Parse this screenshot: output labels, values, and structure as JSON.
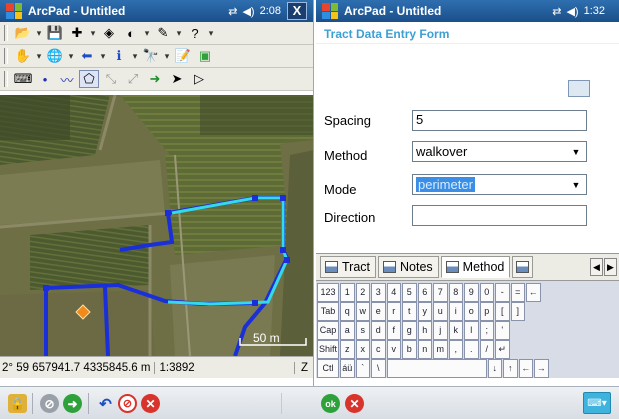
{
  "left_window": {
    "title": "ArcPad - Untitled",
    "time": "2:08",
    "close_label": "X",
    "signal_icon": "signal-icon",
    "volume_icon": "volume-icon"
  },
  "right_window": {
    "title": "ArcPad - Untitled",
    "time": "1:32"
  },
  "toolbar_rows": [
    [
      "open-folder-icon",
      "save-icon",
      "add-layer-icon",
      "layers-icon",
      "legend-icon",
      "tools-icon",
      "help-icon"
    ],
    [
      "pan-hand-icon",
      "globe-zoom-icon",
      "back-arrow-icon",
      "identify-icon",
      "find-icon",
      "notes-icon",
      "form-icon"
    ],
    [
      "keyboard-icon",
      "point-icon",
      "polyline-icon",
      "polygon-icon",
      "vertex-edit-icon",
      "vertex-add-icon",
      "gps-go-icon",
      "select-arrow-icon",
      "select-outline-icon"
    ]
  ],
  "map": {
    "scale_bar_label": "50 m",
    "accent_line_color": "#36d9e8",
    "boundary_color": "#1a2fd8",
    "marker_color": "#f08a1a"
  },
  "statusbar": {
    "coords": "2° 59 657941.7 4335845.6 m",
    "scale": "1:3892",
    "z_label": "Z"
  },
  "form": {
    "title": "Tract Data Entry Form",
    "fields": {
      "spacing": {
        "label": "Spacing",
        "value": "5"
      },
      "method": {
        "label": "Method",
        "value": "walkover"
      },
      "mode": {
        "label": "Mode",
        "value": "perimeter"
      },
      "direction": {
        "label": "Direction",
        "value": ""
      }
    },
    "tabs": [
      "Tract",
      "Notes",
      "Method"
    ]
  },
  "keyboard": {
    "rows": [
      [
        "123",
        "1",
        "2",
        "3",
        "4",
        "5",
        "6",
        "7",
        "8",
        "9",
        "0",
        "-",
        "=",
        "←"
      ],
      [
        "Tab",
        "q",
        "w",
        "e",
        "r",
        "t",
        "y",
        "u",
        "i",
        "o",
        "p",
        "[",
        "]"
      ],
      [
        "Cap",
        "a",
        "s",
        "d",
        "f",
        "g",
        "h",
        "j",
        "k",
        "l",
        ";",
        "'"
      ],
      [
        "Shift",
        "z",
        "x",
        "c",
        "v",
        "b",
        "n",
        "m",
        ",",
        ".",
        "/",
        "↵"
      ],
      [
        "Ctl",
        "áü",
        "`",
        "\\",
        "",
        "↓",
        "↑",
        "←",
        "→"
      ]
    ]
  },
  "bottombar": {
    "ok_label": "ok",
    "accent_green": "#2fa13a",
    "accent_red": "#d9342b"
  }
}
